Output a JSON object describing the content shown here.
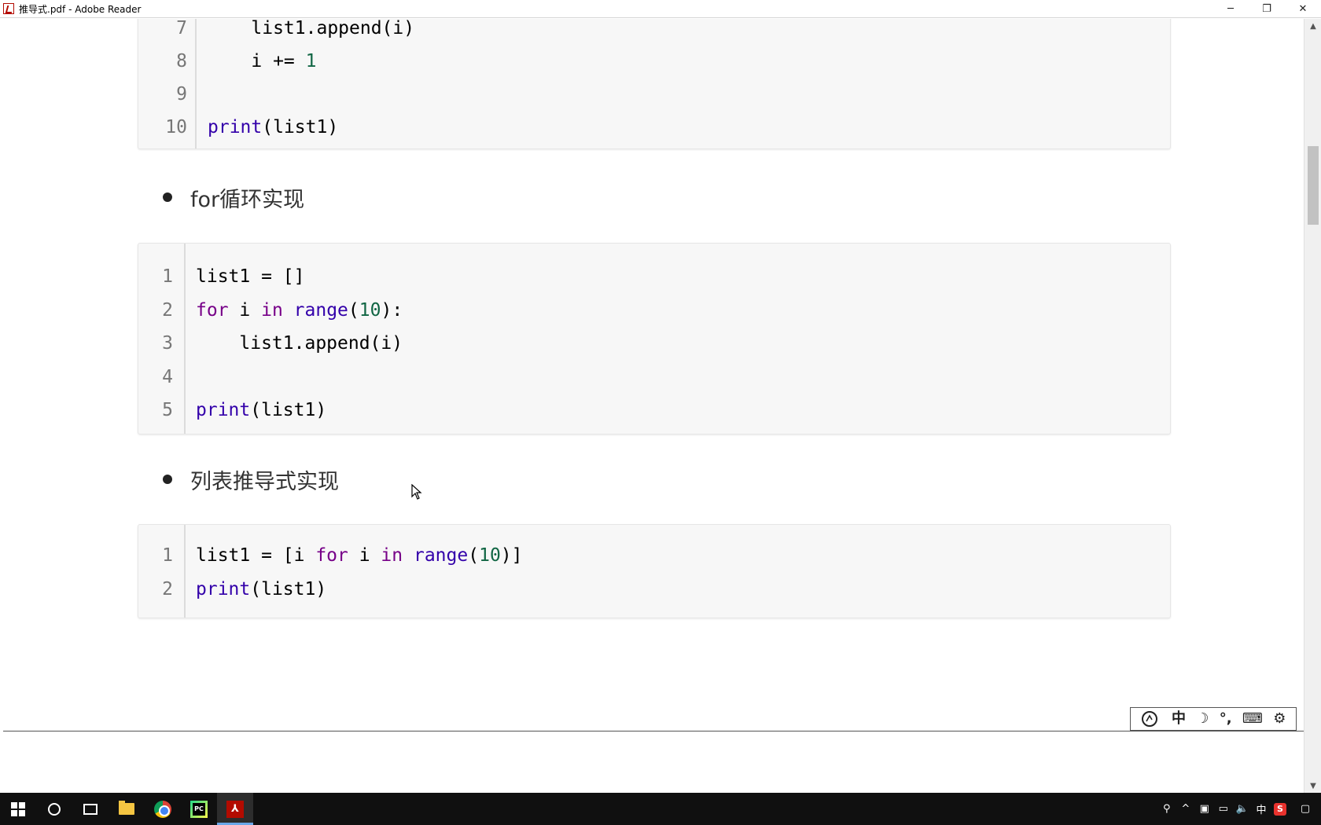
{
  "window": {
    "title": "推导式.pdf - Adobe Reader",
    "minimize": "─",
    "restore": "❐",
    "close": "✕"
  },
  "code_block_1": {
    "lines": [
      {
        "n": "7",
        "indent": "    ",
        "tokens": [
          {
            "t": "list1.append(i)",
            "c": ""
          }
        ]
      },
      {
        "n": "8",
        "indent": "    ",
        "tokens": [
          {
            "t": "i += ",
            "c": ""
          },
          {
            "t": "1",
            "c": "num"
          }
        ]
      },
      {
        "n": "9",
        "indent": "",
        "tokens": []
      },
      {
        "n": "10",
        "indent": "",
        "tokens": [
          {
            "t": "print",
            "c": "bi"
          },
          {
            "t": "(list1)",
            "c": ""
          }
        ]
      }
    ]
  },
  "bullet_1": "for循环实现",
  "code_block_2": {
    "lines": [
      {
        "n": "1",
        "indent": "",
        "tokens": [
          {
            "t": "list1 = []",
            "c": ""
          }
        ]
      },
      {
        "n": "2",
        "indent": "",
        "tokens": [
          {
            "t": "for",
            "c": "kw"
          },
          {
            "t": " i ",
            "c": ""
          },
          {
            "t": "in",
            "c": "kw"
          },
          {
            "t": " ",
            "c": ""
          },
          {
            "t": "range",
            "c": "bi"
          },
          {
            "t": "(",
            "c": ""
          },
          {
            "t": "10",
            "c": "num"
          },
          {
            "t": "):",
            "c": ""
          }
        ]
      },
      {
        "n": "3",
        "indent": "    ",
        "tokens": [
          {
            "t": "list1.append(i)",
            "c": ""
          }
        ]
      },
      {
        "n": "4",
        "indent": "",
        "tokens": []
      },
      {
        "n": "5",
        "indent": "",
        "tokens": [
          {
            "t": "print",
            "c": "bi"
          },
          {
            "t": "(list1)",
            "c": ""
          }
        ]
      }
    ]
  },
  "bullet_2": "列表推导式实现",
  "code_block_3": {
    "lines": [
      {
        "n": "1",
        "indent": "",
        "tokens": [
          {
            "t": "list1 = [i ",
            "c": ""
          },
          {
            "t": "for",
            "c": "kw"
          },
          {
            "t": " i ",
            "c": ""
          },
          {
            "t": "in",
            "c": "kw"
          },
          {
            "t": " ",
            "c": ""
          },
          {
            "t": "range",
            "c": "bi"
          },
          {
            "t": "(",
            "c": ""
          },
          {
            "t": "10",
            "c": "num"
          },
          {
            "t": ")]",
            "c": ""
          }
        ]
      },
      {
        "n": "2",
        "indent": "",
        "tokens": [
          {
            "t": "print",
            "c": "bi"
          },
          {
            "t": "(list1)",
            "c": ""
          }
        ]
      }
    ]
  },
  "ime_toolbar": {
    "items": [
      "中",
      "☽",
      "°,",
      "⌨",
      "⚙"
    ]
  },
  "taskbar": {
    "tray": {
      "ime_mode": "中",
      "sogou": "S"
    }
  }
}
